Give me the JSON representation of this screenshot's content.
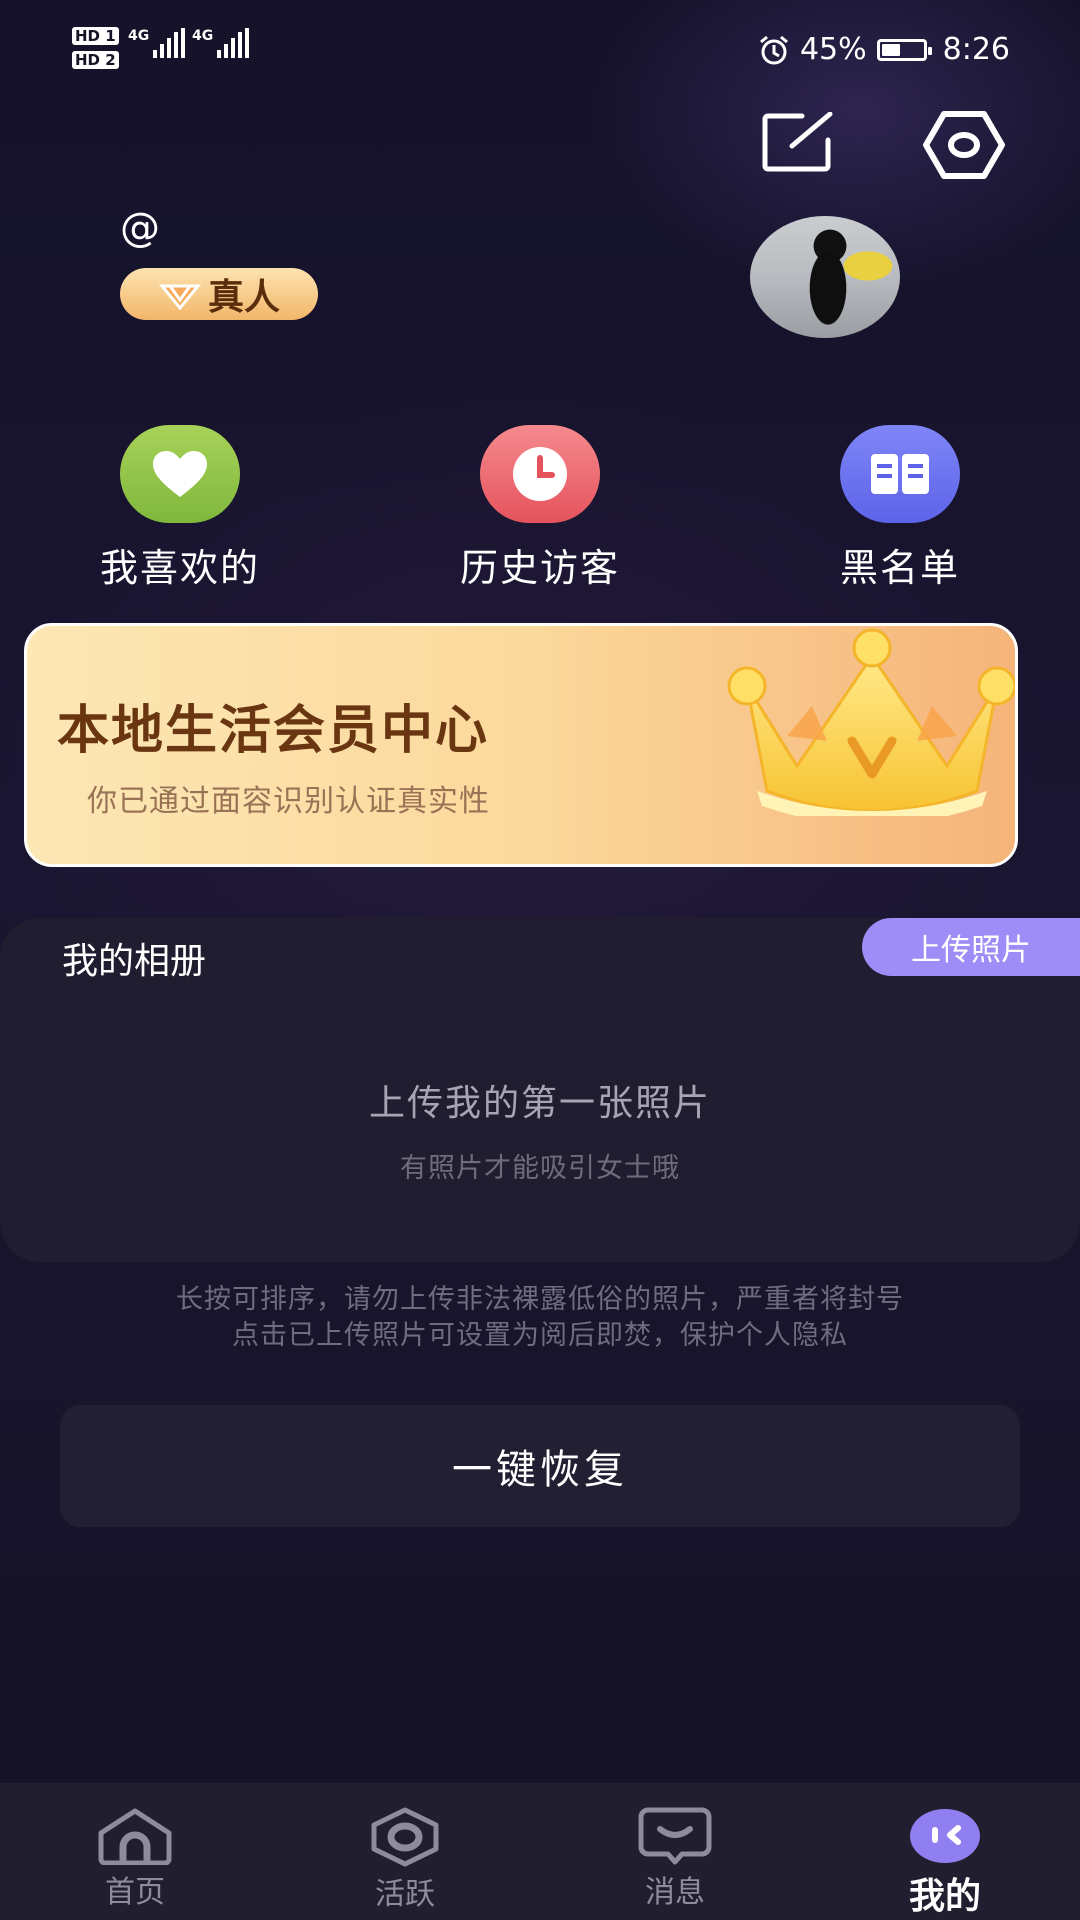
{
  "status_bar": {
    "sim1": "HD 1",
    "sim2": "HD 2",
    "network1": "4G",
    "network2": "4G",
    "battery_percent": "45%",
    "battery_level": 0.45,
    "time": "8:26"
  },
  "profile": {
    "at_sign": "@",
    "badge": "真人"
  },
  "quick_actions": [
    {
      "label": "我喜欢的",
      "color": "#8bc34a"
    },
    {
      "label": "历史访客",
      "color": "#f06a72"
    },
    {
      "label": "黑名单",
      "color": "#6e75f1"
    }
  ],
  "banner": {
    "title": "本地生活会员中心",
    "subtitle": "你已通过面容识别认证真实性"
  },
  "album": {
    "title": "我的相册",
    "upload_label": "上传照片",
    "empty_title": "上传我的第一张照片",
    "empty_subtitle": "有照片才能吸引女士哦"
  },
  "notes": {
    "line1": "长按可排序，请勿上传非法裸露低俗的照片，严重者将封号",
    "line2": "点击已上传照片可设置为阅后即焚，保护个人隐私"
  },
  "restore_button": "一键恢复",
  "tabs": [
    {
      "label": "首页",
      "icon": "home-icon"
    },
    {
      "label": "活跃",
      "icon": "active-icon"
    },
    {
      "label": "消息",
      "icon": "message-icon"
    },
    {
      "label": "我的",
      "icon": "me-icon",
      "active": true
    }
  ],
  "colors": {
    "background": "#161327",
    "accent": "#9e8df6",
    "banner_title": "#6a3611"
  }
}
